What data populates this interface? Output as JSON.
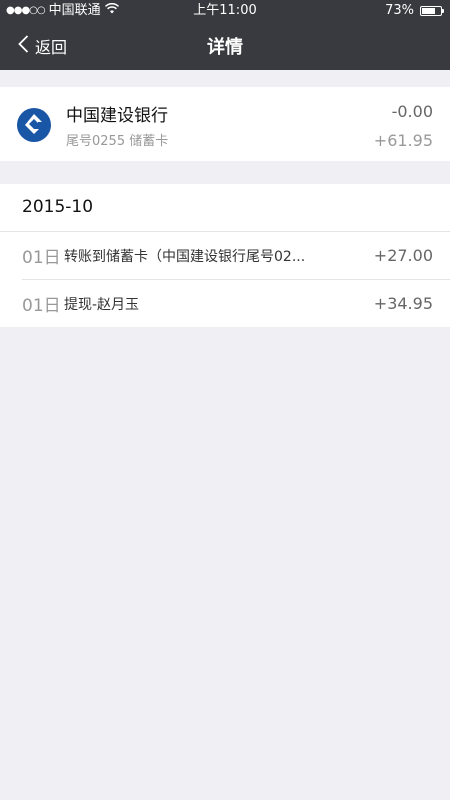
{
  "status_bar": {
    "signal_dots": "●●●○○",
    "carrier": "中国联通",
    "time": "上午11:00",
    "battery": "73%",
    "battery_level": 0.73
  },
  "nav": {
    "back_label": "返回",
    "title": "详情"
  },
  "bank": {
    "name": "中国建设银行",
    "sub": "尾号0255  储蓄卡",
    "amount_top": "-0.00",
    "amount_bottom": "+61.95",
    "logo_color": "#1a56a6"
  },
  "transactions": {
    "month": "2015-10",
    "rows": [
      {
        "day": "01日",
        "desc": "转账到储蓄卡（中国建设银行尾号02...",
        "amount": "+27.00"
      },
      {
        "day": "01日",
        "desc": "提现-赵月玉",
        "amount": "+34.95"
      }
    ]
  },
  "colors": {
    "topbar": "#393a3f",
    "background": "#efeff4"
  }
}
